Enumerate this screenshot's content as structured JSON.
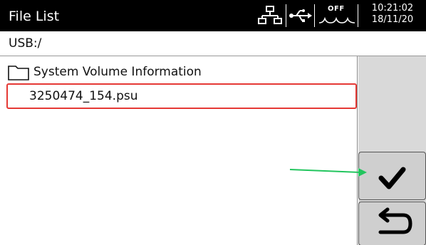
{
  "header": {
    "title": "File List",
    "icons": [
      "network-icon",
      "usb-icon",
      "output-off-icon"
    ],
    "output_status": "OFF",
    "time": "10:21:02",
    "date": "18/11/20"
  },
  "path": "USB:/",
  "files": [
    {
      "type": "folder",
      "name": "System Volume Information"
    },
    {
      "type": "file",
      "name": "3250474_154.psu",
      "selected": true
    }
  ],
  "buttons": {
    "confirm_icon": "checkmark-icon",
    "back_icon": "return-arrow-icon"
  },
  "colors": {
    "header_bg": "#000000",
    "selection_border": "#e53935",
    "annotation_arrow": "#22c55e",
    "side_panel": "#d9d9d9"
  }
}
